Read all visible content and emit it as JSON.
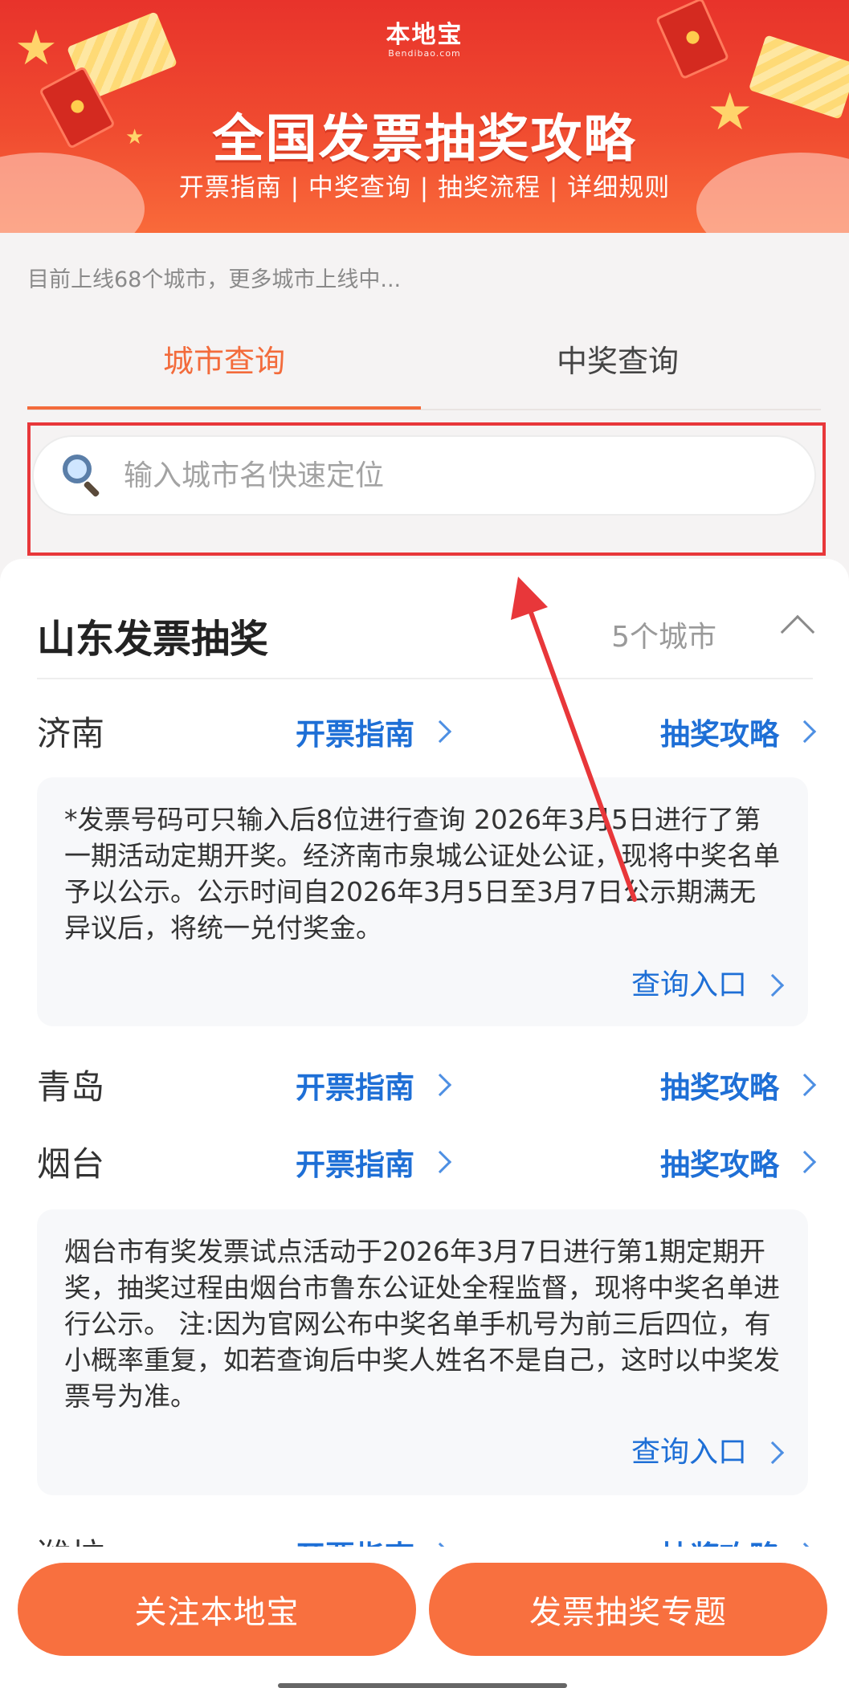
{
  "banner": {
    "logo_text": "本地宝",
    "logo_sub": "Bendibao.com",
    "title": "全国发票抽奖攻略",
    "subtitle": "开票指南 | 中奖查询 | 抽奖流程 | 详细规则"
  },
  "notice": "目前上线68个城市，更多城市上线中...",
  "tabs": [
    {
      "label": "城市查询",
      "active": true
    },
    {
      "label": "中奖查询",
      "active": false
    }
  ],
  "search": {
    "placeholder": "输入城市名快速定位",
    "value": ""
  },
  "section": {
    "title": "山东发票抽奖",
    "count": "5个城市"
  },
  "cities": [
    {
      "name": "济南",
      "guide_label": "开票指南",
      "strategy_label": "抽奖攻略",
      "info": "*发票号码可只输入后8位进行查询 2026年3月5日进行了第一期活动定期开奖。经济南市泉城公证处公证，现将中奖名单予以公示。公示时间自2026年3月5日至3月7日公示期满无异议后，将统一兑付奖金。",
      "query_label": "查询入口"
    },
    {
      "name": "青岛",
      "guide_label": "开票指南",
      "strategy_label": "抽奖攻略"
    },
    {
      "name": "烟台",
      "guide_label": "开票指南",
      "strategy_label": "抽奖攻略",
      "info": "烟台市有奖发票试点活动于2026年3月7日进行第1期定期开奖，抽奖过程由烟台市鲁东公证处全程监督，现将中奖名单进行公示。 注:因为官网公布中奖名单手机号为前三后四位，有小概率重复，如若查询后中奖人姓名不是自己，这时以中奖发票号为准。",
      "query_label": "查询入口"
    },
    {
      "name": "潍坊",
      "guide_label": "开票指南",
      "strategy_label": "抽奖攻略"
    }
  ],
  "buttons": {
    "follow": "关注本地宝",
    "topic": "发票抽奖专题"
  },
  "colors": {
    "accent": "#f36b3b",
    "link": "#1e6fd6",
    "highlight": "#e8373a",
    "button": "#f8703f"
  }
}
